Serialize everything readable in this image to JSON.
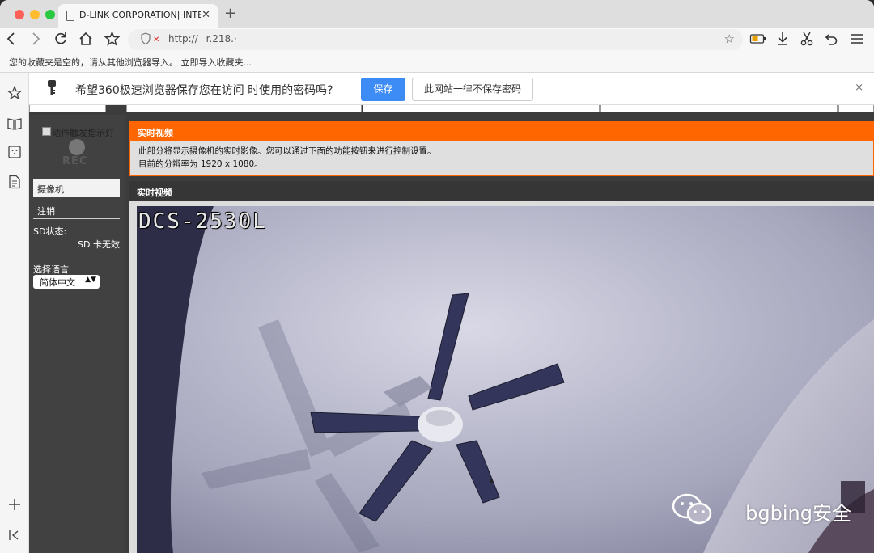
{
  "browser": {
    "tab_title": "D-LINK CORPORATION| INTE",
    "new_tab": "+",
    "tab_close": "✕",
    "url": "http://_ r.218.·",
    "bookmark_bar_text": "您的收藏夹是空的，请从其他浏览器导入。 立即导入收藏夹...",
    "icons": [
      "back-icon",
      "forward-icon",
      "reload-icon",
      "home-icon",
      "bookmark-star-icon",
      "battery-icon",
      "download-icon",
      "scissors-icon",
      "undo-icon",
      "menu-icon"
    ]
  },
  "password_prompt": {
    "message": "希望360极速浏览器保存您在访问  时使用的密码吗?",
    "save_label": "保存",
    "never_label": "此网站一律不保存密码",
    "close": "×"
  },
  "sidebar": {
    "rec_alt": "动作触发指示灯",
    "rec_text": "REC",
    "items": [
      {
        "label": "摄像机"
      },
      {
        "label": "注销"
      }
    ],
    "sd_label": "SD状态:",
    "sd_value": "SD 卡无效",
    "language_label": "选择语言",
    "language_value": "简体中文"
  },
  "live_video": {
    "info_title": "实时视频",
    "info_line1": "此部分将显示摄像机的实时影像。您可以通过下面的功能按钮来进行控制设置。",
    "info_line2": "目前的分辨率为 1920 x 1080。",
    "video_title": "实时视频",
    "camera_overlay": "DCS-2530L",
    "watermark": "bgbing安全"
  },
  "colors": {
    "accent_orange": "#ff6600",
    "save_blue": "#3d8bf5"
  }
}
